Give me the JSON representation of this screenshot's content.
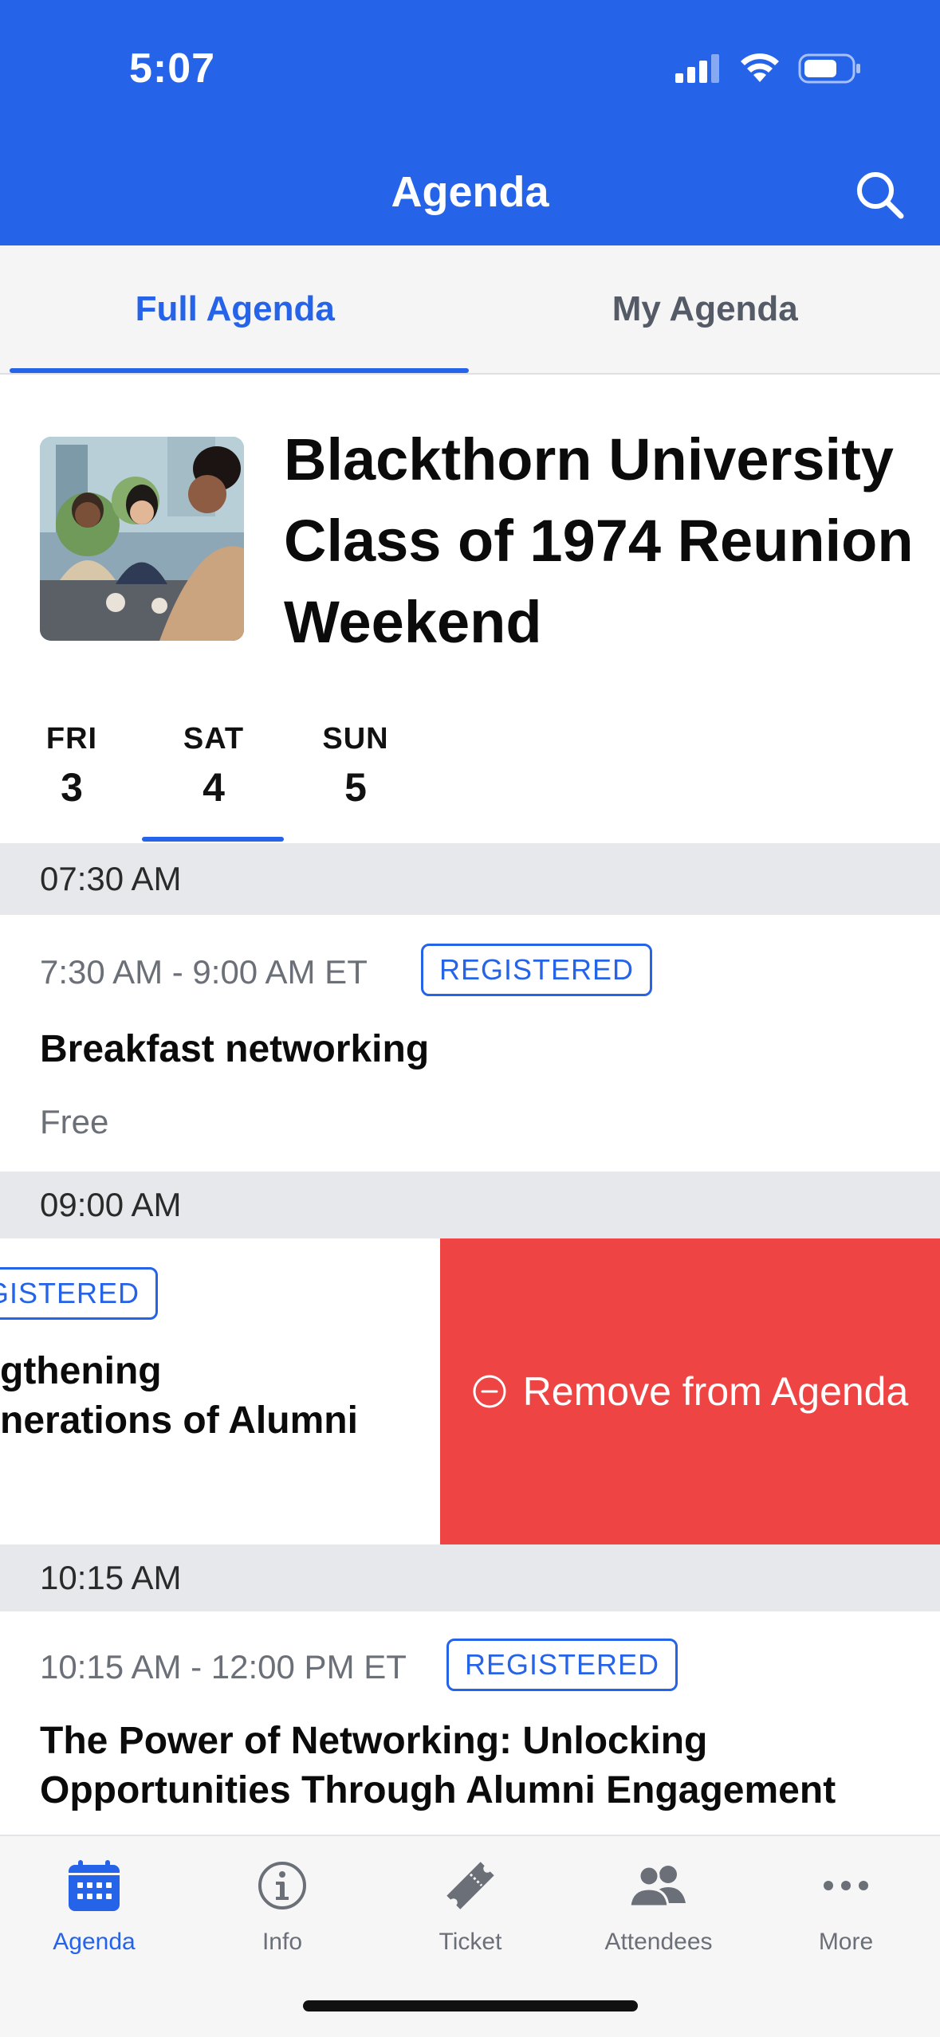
{
  "status_bar": {
    "time": "5:07"
  },
  "header": {
    "title": "Agenda"
  },
  "tabs": [
    {
      "label": "Full Agenda",
      "active": true
    },
    {
      "label": "My Agenda",
      "active": false
    }
  ],
  "event": {
    "title_lines": [
      "Blackthorn University",
      "Class of 1974 Reunion",
      "Weekend"
    ]
  },
  "days": [
    {
      "dow": "FRI",
      "num": "3",
      "active": false
    },
    {
      "dow": "SAT",
      "num": "4",
      "active": true
    },
    {
      "dow": "SUN",
      "num": "5",
      "active": false
    }
  ],
  "schedule": {
    "band_1": "07:30 AM",
    "session_1": {
      "time": "7:30 AM - 9:00 AM ET",
      "badge": "REGISTERED",
      "title": "Breakfast networking",
      "price": "Free"
    },
    "band_2": "09:00 AM",
    "session_2": {
      "badge": "GISTERED",
      "title_line_1": "gthening",
      "title_line_2": "nerations of Alumni",
      "swipe_action": "Remove from Agenda"
    },
    "band_3": "10:15 AM",
    "session_3": {
      "time": "10:15 AM - 12:00 PM ET",
      "badge": "REGISTERED",
      "title_line_1": "The Power of Networking: Unlocking",
      "title_line_2": "Opportunities Through Alumni Engagement"
    }
  },
  "bottom_nav": [
    {
      "label": "Agenda",
      "icon": "calendar-icon",
      "active": true
    },
    {
      "label": "Info",
      "icon": "info-icon",
      "active": false
    },
    {
      "label": "Ticket",
      "icon": "ticket-icon",
      "active": false
    },
    {
      "label": "Attendees",
      "icon": "people-icon",
      "active": false
    },
    {
      "label": "More",
      "icon": "more-icon",
      "active": false
    }
  ],
  "colors": {
    "brand": "#2563e8",
    "danger": "#ef4444",
    "band": "#e7e8eb"
  }
}
